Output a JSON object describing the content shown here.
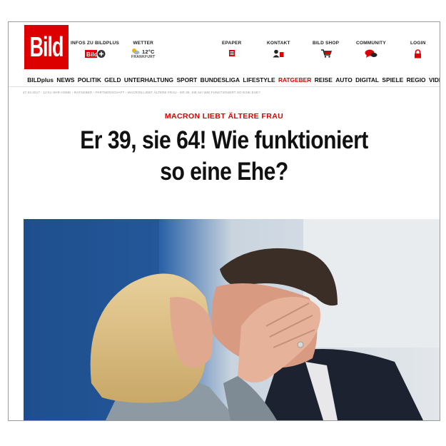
{
  "brand": {
    "logo_text": "Bild",
    "logo_color": "#dd0000"
  },
  "header": {
    "infos_label": "INFOS ZU BILDPLUS",
    "weather_label": "WETTER",
    "weather_temp": "12°C",
    "weather_city": "FRANKFURT",
    "epaper_label": "EPAPER",
    "kontakt_label": "KONTAKT",
    "shop_label": "BILD SHOP",
    "community_label": "COMMUNITY",
    "login_label": "LOGIN"
  },
  "nav": {
    "items": [
      "BILDplus",
      "NEWS",
      "POLITIK",
      "GELD",
      "UNTERHALTUNG",
      "SPORT",
      "BUNDESLIGA",
      "LIFESTYLE",
      "RATGEBER",
      "REISE",
      "AUTO",
      "DIGITAL",
      "SPIELE",
      "REGIO",
      "VIDEO"
    ],
    "active": "RATGEBER"
  },
  "breadcrumb": "27.04.2017 - 12:51 UHR   HOME › RATGEBER › PARTNERSCHAFT › MACRON LIEBT ÄLTERE FRAU - ER 39, SIE 64! WIE FUNKTIONIERT SO EINE EHE?",
  "article": {
    "kicker": "MACRON LIEBT ÄLTERE FRAU",
    "headline_line1": "Er 39, sie 64! Wie funktioniert",
    "headline_line2": "so eine Ehe?"
  },
  "colors": {
    "accent": "#dd0000",
    "text": "#111111"
  },
  "icons": [
    "home-icon",
    "bildplus-icon",
    "weather-icon",
    "epaper-icon",
    "kontakt-icon",
    "cart-icon",
    "community-icon",
    "lock-icon",
    "search-icon"
  ]
}
